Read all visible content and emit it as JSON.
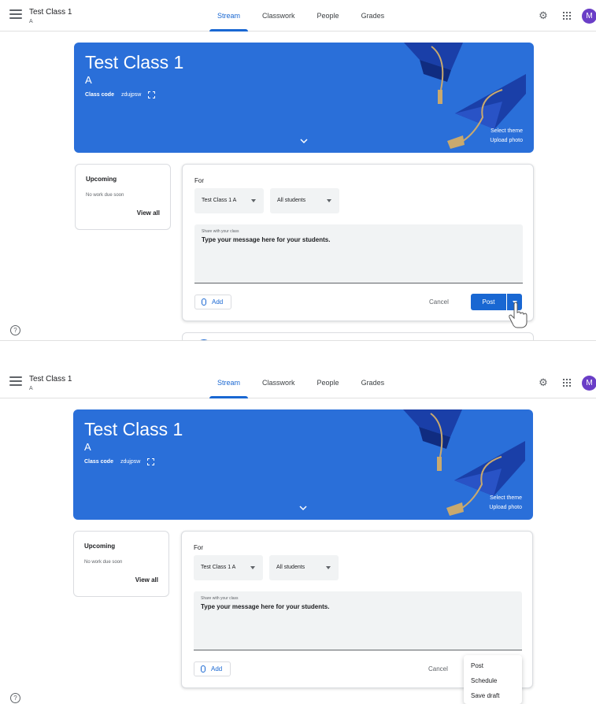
{
  "header": {
    "class_title": "Test Class 1",
    "class_section": "A",
    "tabs": [
      {
        "label": "Stream",
        "active": true
      },
      {
        "label": "Classwork",
        "active": false
      },
      {
        "label": "People",
        "active": false
      },
      {
        "label": "Grades",
        "active": false
      }
    ],
    "avatar_initial": "M",
    "avatar_color": "#6a3ec7"
  },
  "banner": {
    "title": "Test Class 1",
    "section": "A",
    "class_code_label": "Class code",
    "class_code": "zdujpsw",
    "select_theme": "Select theme",
    "upload_photo": "Upload photo",
    "color": "#2a6fd9"
  },
  "upcoming": {
    "title": "Upcoming",
    "empty_text": "No work due soon",
    "view_all": "View all"
  },
  "composer": {
    "for_label": "For",
    "class_select": "Test Class 1 A",
    "students_select": "All students",
    "textarea_label": "Share with your class",
    "textarea_placeholder": "Type your message here for your students.",
    "add_label": "Add",
    "cancel_label": "Cancel",
    "post_label": "Post"
  },
  "post_menu": {
    "items": [
      "Post",
      "Schedule",
      "Save draft"
    ]
  },
  "accent_color": "#1967d2"
}
